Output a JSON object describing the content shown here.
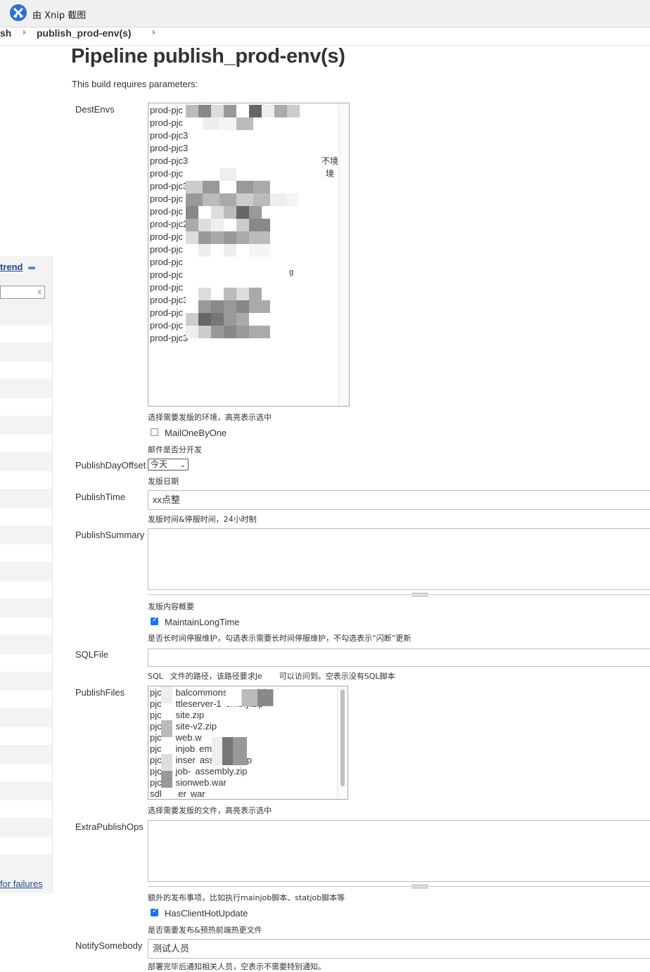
{
  "topbar": {
    "app_title": "由 Xnip 截图",
    "logo_icon": "xnip-logo-icon"
  },
  "breadcrumb": {
    "prev": "sh",
    "current": "publish_prod-env(s)"
  },
  "sidebar": {
    "trend_label": "trend",
    "filter_clear": "x",
    "failures_label": "for failures"
  },
  "page": {
    "title": "Pipeline publish_prod-env(s)",
    "subtitle": "This build requires parameters:"
  },
  "params": {
    "dest_envs": {
      "label": "DestEnvs",
      "options": [
        "prod-pjc",
        "prod-pjc",
        "prod-pjc3",
        "prod-pjc3",
        "prod-pjc3",
        "prod-pjc",
        "prod-pjc3",
        "prod-pjc",
        "prod-pjc",
        "prod-pjc2",
        "prod-pjc",
        "prod-pjc",
        "prod-pjc",
        "prod-pjc",
        "prod-pjc",
        "prod-pjc3",
        "prod-pjc",
        "prod-pjc",
        "prod-pjc3"
      ],
      "suffix_a": "不境",
      "suffix_b": "境",
      "suffix_c": "g",
      "description": "选择需要发版的环境，高亮表示选中"
    },
    "mail_one_by_one": {
      "label": "MailOneByOne",
      "checked": false,
      "description": "邮件是否分开发"
    },
    "publish_day_offset": {
      "label": "PublishDayOffset",
      "value": "今天",
      "description": "发版日期"
    },
    "publish_time": {
      "label": "PublishTime",
      "value": "xx点整",
      "description": "发版时间&停服时间，24小时制"
    },
    "publish_summary": {
      "label": "PublishSummary",
      "value": "",
      "description": "发版内容概要"
    },
    "maintain_long_time": {
      "label": "MaintainLongTime",
      "checked": true,
      "description": "是否长时间停服维护，勾选表示需要长时间停服维护，不勾选表示“闪断”更新"
    },
    "sql_file": {
      "label": "SQLFile",
      "value": "",
      "description": {
        "part1": "SQL",
        "part2": "文件的路径，该路径要求Je",
        "part3": "可以访问到。空表示没有SQL脚本"
      }
    },
    "publish_files": {
      "label": "PublishFiles",
      "options": [
        {
          "prefix": "pjc",
          "middle": "balcommons",
          "suffix": "assembly.zip"
        },
        {
          "prefix": "pjc",
          "middle": "ttleserver-1",
          "suffix": "embly.zip"
        },
        {
          "prefix": "pjc",
          "middle": "site.zip",
          "suffix": ""
        },
        {
          "prefix": "pjc",
          "middle": "site-v2.zip",
          "suffix": ""
        },
        {
          "prefix": "pjc",
          "middle": "web.w",
          "suffix": ""
        },
        {
          "prefix": "pjc",
          "middle": "injob",
          "suffix": "embly.zip"
        },
        {
          "prefix": "pjc",
          "middle": "inser",
          "suffix": "assembly.zip"
        },
        {
          "prefix": "pjc",
          "middle": "job-",
          "suffix": "assembly.zip"
        },
        {
          "prefix": "pjc",
          "middle": "sionweb.war",
          "suffix": ""
        },
        {
          "prefix": "sdk",
          "middle": "er",
          "suffix": "war"
        }
      ],
      "description": "选择需要发版的文件，高亮表示选中"
    },
    "extra_publish_ops": {
      "label": "ExtraPublishOps",
      "value": "",
      "description": "额外的发布事项，比如执行mainjob脚本、statjob脚本等"
    },
    "has_client_hot_update": {
      "label": "HasClientHotUpdate",
      "checked": true,
      "description": "是否需要发布&预热前端热更文件"
    },
    "notify_somebody": {
      "label": "NotifySomebody",
      "value": "测试人员",
      "description": "部署完毕后通知相关人员，空表示不需要特别通知。"
    }
  },
  "colors": {
    "link": "#204a87",
    "checkbox_checked": "#1a73e8",
    "text": "#333333"
  }
}
